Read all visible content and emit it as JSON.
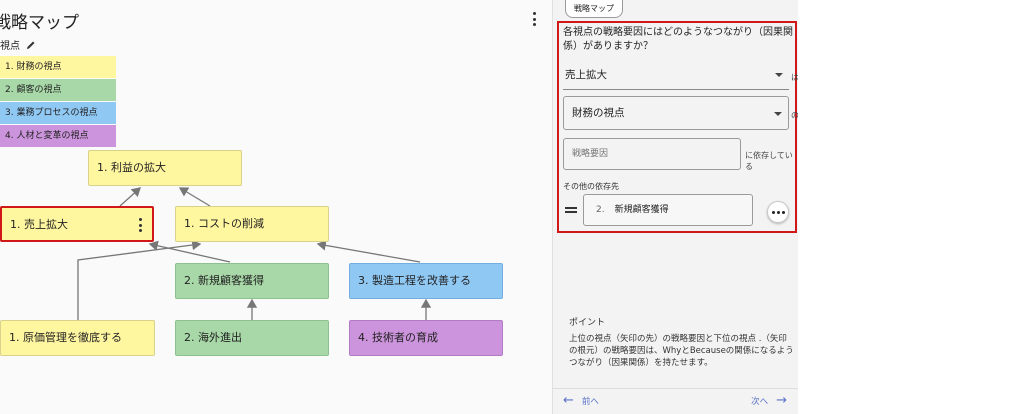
{
  "map": {
    "title": "戦略マップ",
    "perspectives_label": "視点",
    "perspectives": [
      {
        "label": "1. 財務の視点",
        "color": "#fff6a0"
      },
      {
        "label": "2. 顧客の視点",
        "color": "#a8d8a8"
      },
      {
        "label": "3. 業務プロセスの視点",
        "color": "#90c8f4"
      },
      {
        "label": "4. 人材と変革の視点",
        "color": "#cc94dc"
      }
    ],
    "nodes": [
      {
        "id": "n1",
        "label": "1. 利益の拡大"
      },
      {
        "id": "n2",
        "label": "1. 売上拡大"
      },
      {
        "id": "n3",
        "label": "1. コストの削減"
      },
      {
        "id": "n4",
        "label": "2. 新規顧客獲得"
      },
      {
        "id": "n5",
        "label": "3. 製造工程を改善する"
      },
      {
        "id": "n6",
        "label": "1. 原価管理を徹底する"
      },
      {
        "id": "n7",
        "label": "2. 海外進出"
      },
      {
        "id": "n8",
        "label": "4. 技術者の育成"
      }
    ]
  },
  "panel": {
    "tab_label": "戦略マップ",
    "question": "各視点の戦略要因にはどのようなつながり（因果関係）がありますか？",
    "selected_factor": "売上拡大",
    "suffix_wa": "は",
    "perspective_select": "財務の視点",
    "suffix_no": "の",
    "factor_placeholder": "戦略要因",
    "suffix_depends": "に依存している",
    "other_deps_label": "その他の依存先",
    "dependency": {
      "num": "2.",
      "label": "新規顧客獲得"
    },
    "point_title": "ポイント",
    "point_text": "上位の視点（矢印の先）の戦略要因と下位の視点 .（矢印の根元）の戦略要因は、WhyとBecauseの関係になるようつながり（因果関係）を持たせます。",
    "prev_label": "前へ",
    "next_label": "次へ"
  },
  "colors": {
    "highlight": "#d01818",
    "link": "#5b73c8"
  }
}
